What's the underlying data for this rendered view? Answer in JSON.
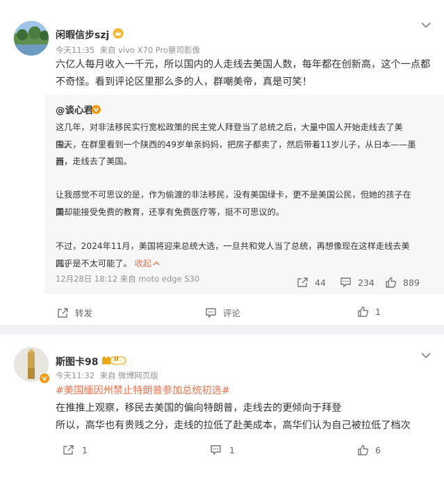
{
  "post1": {
    "user": "闲暇信步szj",
    "time": "今天11:35",
    "source": "来自 vivo X70 Pro蔡司影像",
    "text_lines": [
      "六亿人每月收入一千元，所以国内的人走线去美国人数，每年都在创新高，这个一点都",
      "不奇怪。看到评论区里那么多的人，群嘲美帝，真是可笑！"
    ],
    "repost": {
      "user": "@谈心君",
      "lines": [
        "这几年，对非法移民实行宽松政策的民主党人拜登当了总统之后，大量中国人开始走线去了美国。",
        "今天，在群里看到一个陕西的49岁单亲妈妈，把房子都卖了，然后带着11岁儿子，从日本——墨西",
        "哥，走线去了美国。",
        "让我感觉不可思议的是，作为偷渡的非法移民，没有美国绿卡，更不是美国公民，但她的孩子在美",
        "国却能接受免费的教育，还享有免费医疗等，挺不可思议的。",
        "不过，2024年11月，美国将迎来总统大选，一旦共和党人当了总统，再想像现在这样走线去美国，",
        "几乎是不太可能了。"
      ],
      "collapse": "收起",
      "time": "12月28日 18:12",
      "source": "来自 moto edge S30",
      "reposts": "44",
      "comments": "234",
      "likes": "889"
    },
    "actions": {
      "repost": "转发",
      "comment": "评论",
      "like": "1"
    }
  },
  "post2": {
    "user": "斯图卡98",
    "level": "II",
    "time": "今天11:32",
    "source": "来自 微博网页版",
    "topic": "#美国缅因州禁止特朗普参加总统初选#",
    "lines": [
      "在推推上观察，移民去美国的偏向特朗普，走线去的更倾向于拜登",
      "所以，高华也有贵贱之分，走线的拉低了赴美成本，高华们认为自己被拉低了档次"
    ],
    "actions": {
      "repost": "1",
      "comment": "1",
      "like": "6"
    }
  },
  "colors": {
    "accent": "#eb7350",
    "vip": "#f39a13",
    "muted": "#939393"
  }
}
